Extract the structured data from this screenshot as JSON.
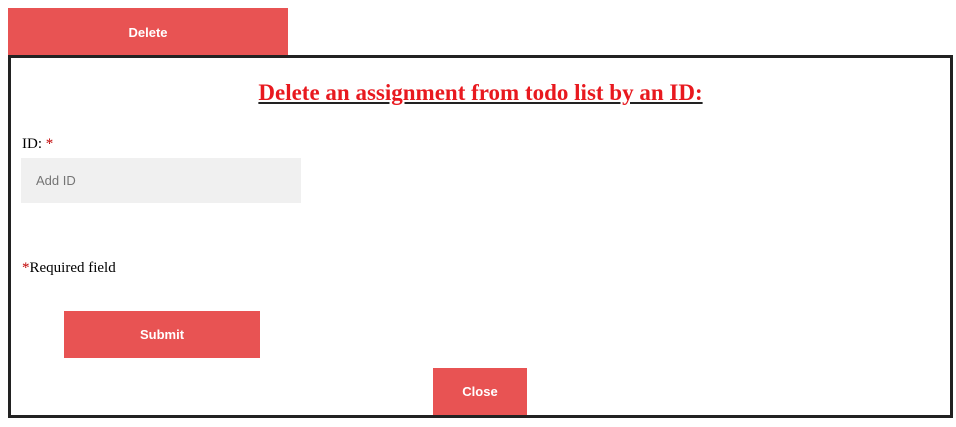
{
  "top_tab": {
    "label": "Delete"
  },
  "modal": {
    "title": "Delete an assignment from todo list by an ID:",
    "id_field": {
      "label": "ID: ",
      "required_marker": "*",
      "placeholder": "Add ID",
      "value": ""
    },
    "required_note": {
      "marker": "*",
      "text": "Required field"
    },
    "submit_label": "Submit",
    "close_label": "Close"
  },
  "colors": {
    "button_bg": "#e85353",
    "title_color": "#e8191f",
    "required_marker": "#c00000",
    "input_bg": "#f0f0f0",
    "modal_border": "#222222"
  }
}
